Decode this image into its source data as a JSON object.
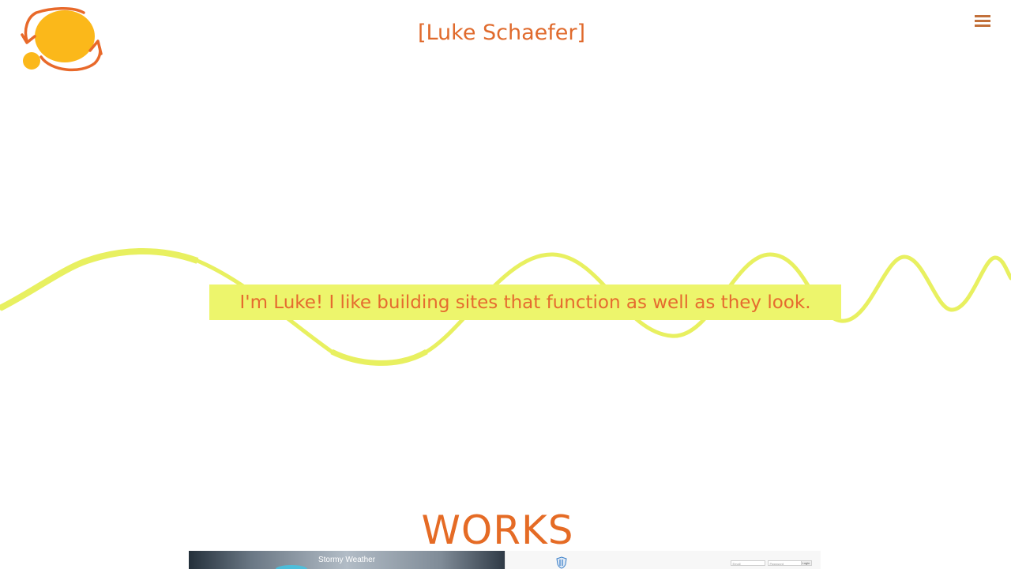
{
  "header": {
    "title": "[Luke Schaefer]",
    "logo_icon": "sun-swirl-logo-icon",
    "menu_icon": "hamburger-menu-icon"
  },
  "hero": {
    "tagline": "I'm Luke!  I like building sites that function as well as they look."
  },
  "works": {
    "title": "WORKS",
    "items": [
      {
        "label": "Stormy Weather"
      },
      {
        "label": "",
        "email_placeholder": "Email",
        "password_placeholder": "Password",
        "login_label": "Login"
      }
    ]
  },
  "colors": {
    "accent": "#e56b2f",
    "tagline_bg": "#edf56c",
    "wave": "#e8f060",
    "logo_fill": "#fbb81a",
    "logo_stroke": "#e8692a"
  }
}
